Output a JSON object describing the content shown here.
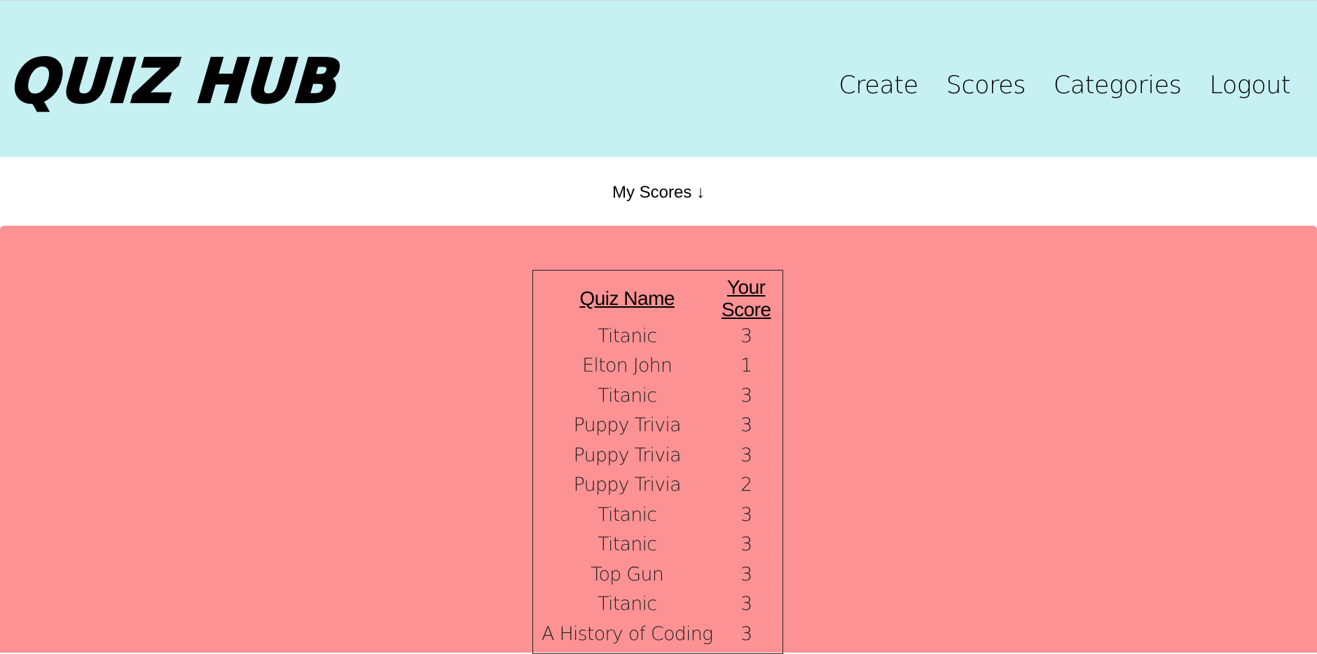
{
  "header": {
    "logo": "Quiz Hub",
    "nav": [
      "Create",
      "Scores",
      "Categories",
      "Logout"
    ]
  },
  "section_title": "My Scores ↓",
  "table": {
    "headers": [
      "Quiz Name",
      "Your Score"
    ],
    "rows": [
      [
        "Titanic",
        "3"
      ],
      [
        "Elton John",
        "1"
      ],
      [
        "Titanic",
        "3"
      ],
      [
        "Puppy Trivia",
        "3"
      ],
      [
        "Puppy Trivia",
        "3"
      ],
      [
        "Puppy Trivia",
        "2"
      ],
      [
        "Titanic",
        "3"
      ],
      [
        "Titanic",
        "3"
      ],
      [
        "Top Gun",
        "3"
      ],
      [
        "Titanic",
        "3"
      ],
      [
        "A History of Coding",
        "3"
      ]
    ]
  },
  "colors": {
    "header_bg": "#c7f0f3",
    "panel_bg": "#fd9294"
  }
}
